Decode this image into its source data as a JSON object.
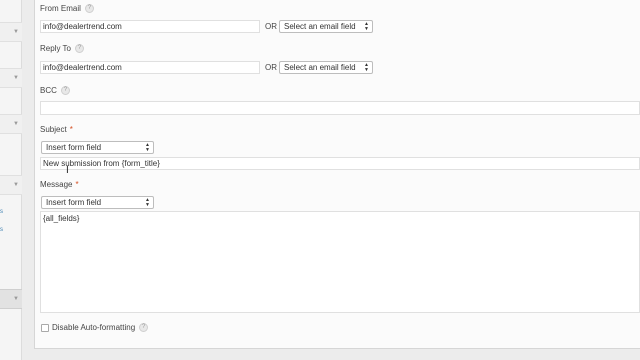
{
  "form": {
    "from_email": {
      "label": "From Email",
      "value": "info@dealertrend.com",
      "or_text": "OR",
      "select_value": "Select an email field"
    },
    "reply_to": {
      "label": "Reply To",
      "value": "info@dealertrend.com",
      "or_text": "OR",
      "select_value": "Select an email field"
    },
    "bcc": {
      "label": "BCC",
      "value": ""
    },
    "subject": {
      "label": "Subject",
      "required_marker": "*",
      "insert_select": "Insert form field",
      "value": "New submission from {form_title}"
    },
    "message": {
      "label": "Message",
      "required_marker": "*",
      "insert_select": "Insert form field",
      "value": "{all_fields}"
    },
    "disable_autoformat": {
      "label": "Disable Auto-formatting",
      "checked": false
    },
    "help_glyph": "?"
  },
  "sidebar": {
    "link_fragments": [
      "s",
      "s"
    ]
  },
  "icons": {
    "help": "help-icon",
    "caret": "select-caret-icon",
    "cursor": "text-cursor-icon"
  }
}
